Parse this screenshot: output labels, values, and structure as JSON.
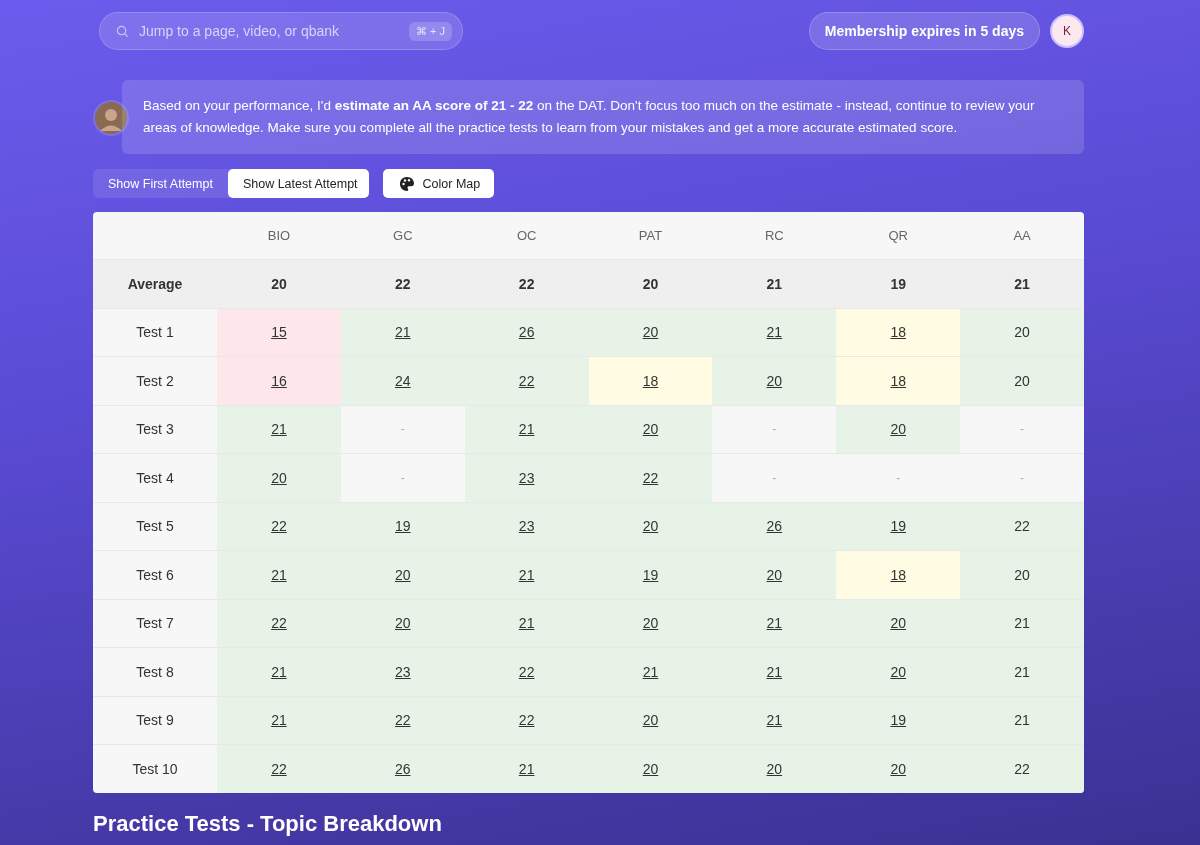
{
  "search": {
    "placeholder": "Jump to a page, video, or qbank",
    "shortcut": "⌘ + J"
  },
  "membership": "Membership expires in 5 days",
  "avatar": "K",
  "estimate": "Based on your performance, I'd **estimate an AA score of 21 - 22** on the DAT. Don't focus too much on the estimate - instead, continue to review your areas of knowledge. Make sure you complete all the practice tests to learn from your mistakes and get a more accurate estimated score.",
  "attempt_toggle": [
    {
      "label": "Show First Attempt",
      "selected": false
    },
    {
      "label": "Show Latest Attempt",
      "selected": true
    }
  ],
  "color_map_button": "Color Map",
  "table": {
    "columns": [
      "BIO",
      "GC",
      "OC",
      "PAT",
      "RC",
      "QR",
      "AA"
    ],
    "average": {
      "label": "Average",
      "values": [
        "20",
        "22",
        "22",
        "20",
        "21",
        "19",
        "21"
      ]
    },
    "rows": [
      {
        "label": "Test 1",
        "cells": [
          {
            "value": "15",
            "color": "#fde7ea",
            "link": true
          },
          {
            "value": "21",
            "color": "#e8f3e8",
            "link": true
          },
          {
            "value": "26",
            "color": "#e8f3e8",
            "link": true
          },
          {
            "value": "20",
            "color": "#e8f3e8",
            "link": true
          },
          {
            "value": "21",
            "color": "#e8f3e8",
            "link": true
          },
          {
            "value": "18",
            "color": "#fffce3",
            "link": true
          },
          {
            "value": "20",
            "color": "#e8f3e8",
            "link": false
          }
        ]
      },
      {
        "label": "Test 2",
        "cells": [
          {
            "value": "16",
            "color": "#fde7ea",
            "link": true
          },
          {
            "value": "24",
            "color": "#e8f3e8",
            "link": true
          },
          {
            "value": "22",
            "color": "#e8f3e8",
            "link": true
          },
          {
            "value": "18",
            "color": "#fffce3",
            "link": true
          },
          {
            "value": "20",
            "color": "#e8f3e8",
            "link": true
          },
          {
            "value": "18",
            "color": "#fffce3",
            "link": true
          },
          {
            "value": "20",
            "color": "#e8f3e8",
            "link": false
          }
        ]
      },
      {
        "label": "Test 3",
        "cells": [
          {
            "value": "21",
            "color": "#e8f3e8",
            "link": true
          },
          {
            "value": "-",
            "link": false
          },
          {
            "value": "21",
            "color": "#e8f3e8",
            "link": true
          },
          {
            "value": "20",
            "color": "#e8f3e8",
            "link": true
          },
          {
            "value": "-",
            "link": false
          },
          {
            "value": "20",
            "color": "#e8f3e8",
            "link": true
          },
          {
            "value": "-",
            "link": false
          }
        ]
      },
      {
        "label": "Test 4",
        "cells": [
          {
            "value": "20",
            "color": "#e8f3e8",
            "link": true
          },
          {
            "value": "-",
            "link": false
          },
          {
            "value": "23",
            "color": "#e8f3e8",
            "link": true
          },
          {
            "value": "22",
            "color": "#e8f3e8",
            "link": true
          },
          {
            "value": "-",
            "link": false
          },
          {
            "value": "-",
            "link": false
          },
          {
            "value": "-",
            "link": false
          }
        ]
      },
      {
        "label": "Test 5",
        "cells": [
          {
            "value": "22",
            "color": "#e8f3e8",
            "link": true
          },
          {
            "value": "19",
            "color": "#e8f3e8",
            "link": true
          },
          {
            "value": "23",
            "color": "#e8f3e8",
            "link": true
          },
          {
            "value": "20",
            "color": "#e8f3e8",
            "link": true
          },
          {
            "value": "26",
            "color": "#e8f3e8",
            "link": true
          },
          {
            "value": "19",
            "color": "#e8f3e8",
            "link": true
          },
          {
            "value": "22",
            "color": "#e8f3e8",
            "link": false
          }
        ]
      },
      {
        "label": "Test 6",
        "cells": [
          {
            "value": "21",
            "color": "#e8f3e8",
            "link": true
          },
          {
            "value": "20",
            "color": "#e8f3e8",
            "link": true
          },
          {
            "value": "21",
            "color": "#e8f3e8",
            "link": true
          },
          {
            "value": "19",
            "color": "#e8f3e8",
            "link": true
          },
          {
            "value": "20",
            "color": "#e8f3e8",
            "link": true
          },
          {
            "value": "18",
            "color": "#fffce3",
            "link": true
          },
          {
            "value": "20",
            "color": "#e8f3e8",
            "link": false
          }
        ]
      },
      {
        "label": "Test 7",
        "cells": [
          {
            "value": "22",
            "color": "#e8f3e8",
            "link": true
          },
          {
            "value": "20",
            "color": "#e8f3e8",
            "link": true
          },
          {
            "value": "21",
            "color": "#e8f3e8",
            "link": true
          },
          {
            "value": "20",
            "color": "#e8f3e8",
            "link": true
          },
          {
            "value": "21",
            "color": "#e8f3e8",
            "link": true
          },
          {
            "value": "20",
            "color": "#e8f3e8",
            "link": true
          },
          {
            "value": "21",
            "color": "#e8f3e8",
            "link": false
          }
        ]
      },
      {
        "label": "Test 8",
        "cells": [
          {
            "value": "21",
            "color": "#e8f3e8",
            "link": true
          },
          {
            "value": "23",
            "color": "#e8f3e8",
            "link": true
          },
          {
            "value": "22",
            "color": "#e8f3e8",
            "link": true
          },
          {
            "value": "21",
            "color": "#e8f3e8",
            "link": true
          },
          {
            "value": "21",
            "color": "#e8f3e8",
            "link": true
          },
          {
            "value": "20",
            "color": "#e8f3e8",
            "link": true
          },
          {
            "value": "21",
            "color": "#e8f3e8",
            "link": false
          }
        ]
      },
      {
        "label": "Test 9",
        "cells": [
          {
            "value": "21",
            "color": "#e8f3e8",
            "link": true
          },
          {
            "value": "22",
            "color": "#e8f3e8",
            "link": true
          },
          {
            "value": "22",
            "color": "#e8f3e8",
            "link": true
          },
          {
            "value": "20",
            "color": "#e8f3e8",
            "link": true
          },
          {
            "value": "21",
            "color": "#e8f3e8",
            "link": true
          },
          {
            "value": "19",
            "color": "#e8f3e8",
            "link": true
          },
          {
            "value": "21",
            "color": "#e8f3e8",
            "link": false
          }
        ]
      },
      {
        "label": "Test 10",
        "cells": [
          {
            "value": "22",
            "color": "#e8f3e8",
            "link": true
          },
          {
            "value": "26",
            "color": "#e8f3e8",
            "link": true
          },
          {
            "value": "21",
            "color": "#e8f3e8",
            "link": true
          },
          {
            "value": "20",
            "color": "#e8f3e8",
            "link": true
          },
          {
            "value": "20",
            "color": "#e8f3e8",
            "link": true
          },
          {
            "value": "20",
            "color": "#e8f3e8",
            "link": true
          },
          {
            "value": "22",
            "color": "#e8f3e8",
            "link": false
          }
        ]
      }
    ]
  },
  "section_title": "Practice Tests - Topic Breakdown"
}
